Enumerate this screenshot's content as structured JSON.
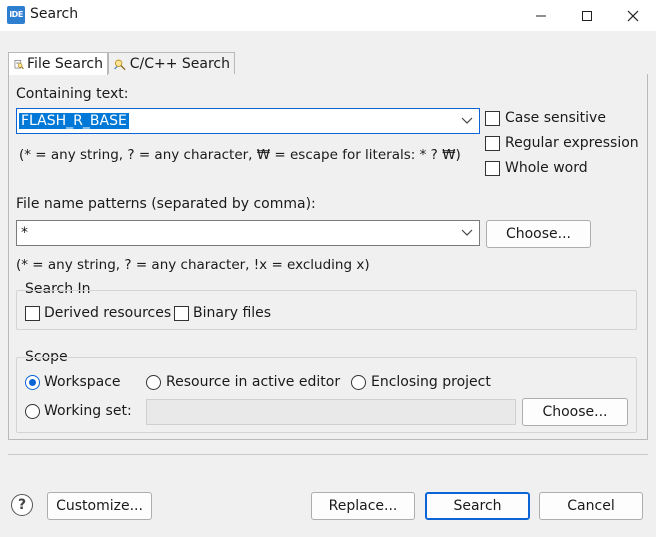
{
  "window": {
    "icon_text": "IDE",
    "title": "Search"
  },
  "tabs": [
    {
      "label": "File Search",
      "active": true
    },
    {
      "label": "C/C++ Search",
      "active": false
    }
  ],
  "containing_text": {
    "label": "Containing text:",
    "value": "FLASH_R_BASE",
    "hint": "(* = any string, ? = any character, ₩ = escape for literals: * ? ₩)"
  },
  "options": {
    "case_sensitive": {
      "label": "Case sensitive",
      "checked": false
    },
    "regular_expression": {
      "label": "Regular expression",
      "checked": false
    },
    "whole_word": {
      "label": "Whole word",
      "checked": false
    }
  },
  "file_name_patterns": {
    "label": "File name patterns (separated by comma):",
    "value": "*",
    "choose_label": "Choose...",
    "hint": "(* = any string, ? = any character, !x = excluding x)"
  },
  "search_in": {
    "title": "Search In",
    "derived_resources": {
      "label": "Derived resources",
      "checked": false
    },
    "binary_files": {
      "label": "Binary files",
      "checked": false
    }
  },
  "scope": {
    "title": "Scope",
    "selected": "Workspace",
    "workspace": "Workspace",
    "resource_in_active_editor": "Resource in active editor",
    "enclosing_project": "Enclosing project",
    "working_set": "Working set:",
    "working_set_value": "",
    "choose_label": "Choose..."
  },
  "footer": {
    "customize_label": "Customize...",
    "replace_label": "Replace...",
    "search_label": "Search",
    "cancel_label": "Cancel"
  },
  "colors": {
    "accent": "#0a64d6",
    "selection": "#0078d7",
    "dialog_bg": "#f0f0f0"
  }
}
